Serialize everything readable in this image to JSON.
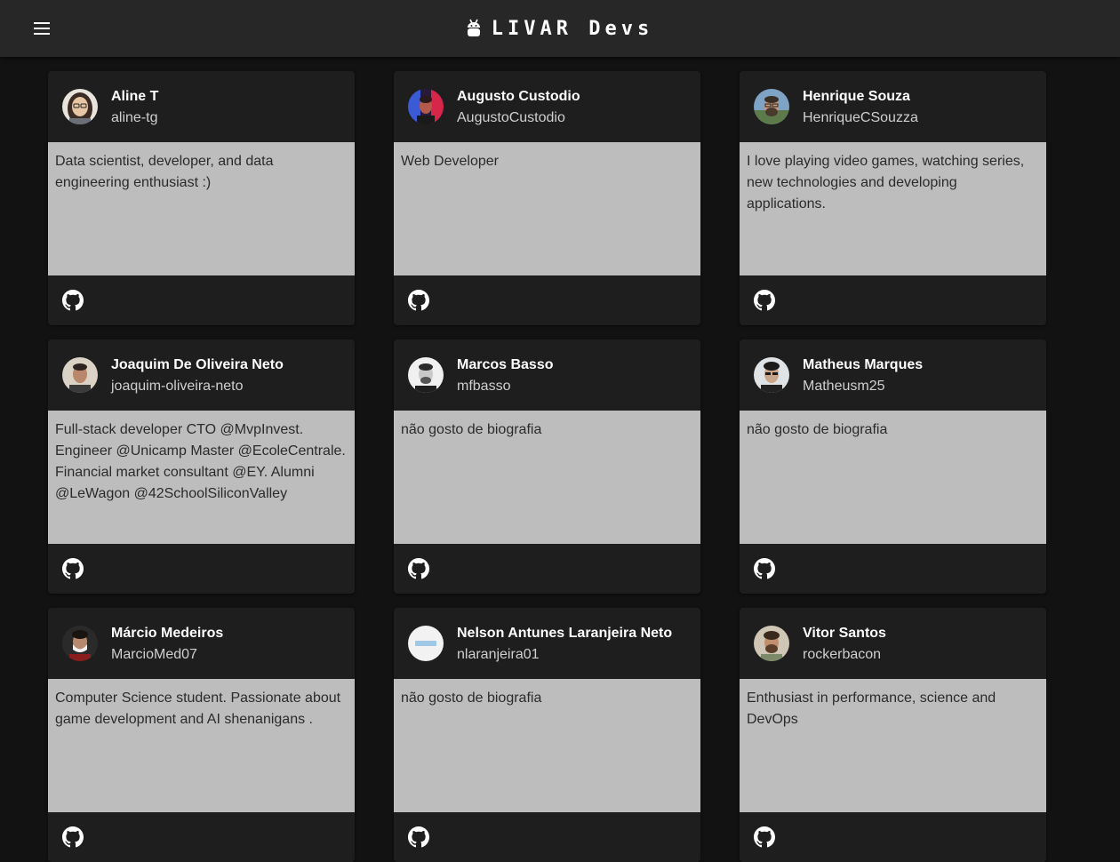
{
  "appbar": {
    "title": "LIVAR Devs",
    "menu_icon": "menu-icon",
    "logo_icon": "android-icon"
  },
  "colors": {
    "background": "#121212",
    "appbar": "#272727",
    "card": "#1e1e1e",
    "bio_background": "#bdbdbd"
  },
  "devs": [
    {
      "name": "Aline T",
      "username": "aline-tg",
      "bio": "Data scientist, developer, and data engineering enthusiast :)",
      "link_icon": "github-icon"
    },
    {
      "name": "Augusto Custodio",
      "username": "AugustoCustodio",
      "bio": "Web Developer",
      "link_icon": "github-icon"
    },
    {
      "name": "Henrique Souza",
      "username": "HenriqueCSouzza",
      "bio": "I love playing video games, watching series, new technologies and developing applications.",
      "link_icon": "github-icon"
    },
    {
      "name": "Joaquim De Oliveira Neto",
      "username": "joaquim-oliveira-neto",
      "bio": "Full-stack developer CTO @MvpInvest. Engineer @Unicamp Master @EcoleCentrale. Financial market consultant @EY. Alumni @LeWagon @42SchoolSiliconValley",
      "link_icon": "github-icon"
    },
    {
      "name": "Marcos Basso",
      "username": "mfbasso",
      "bio": "não gosto de biografia",
      "link_icon": "github-icon"
    },
    {
      "name": "Matheus Marques",
      "username": "Matheusm25",
      "bio": "não gosto de biografia",
      "link_icon": "github-icon"
    },
    {
      "name": "Márcio Medeiros",
      "username": "MarcioMed07",
      "bio": "Computer Science student. Passionate about game development and AI shenanigans .",
      "link_icon": "github-icon"
    },
    {
      "name": "Nelson Antunes Laranjeira Neto",
      "username": "nlaranjeira01",
      "bio": "não gosto de biografia",
      "link_icon": "github-icon"
    },
    {
      "name": "Vitor Santos",
      "username": "rockerbacon",
      "bio": "Enthusiast in performance, science and DevOps",
      "link_icon": "github-icon"
    }
  ]
}
